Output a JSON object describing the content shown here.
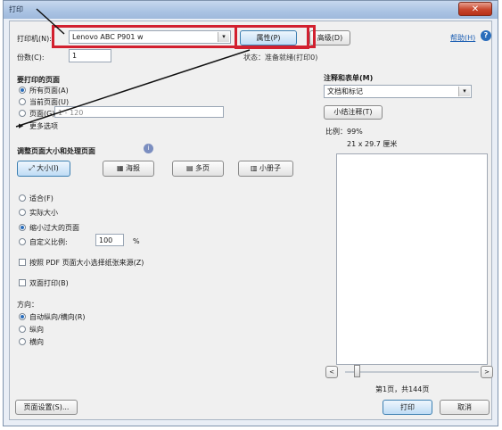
{
  "window": {
    "title": "打印",
    "close_glyph": "✕"
  },
  "printer": {
    "label": "打印机(N):",
    "value": "Lenovo ABC P901 w",
    "properties_button": "属性(P)",
    "advanced_button": "高级(D)",
    "help_link": "帮助(H)",
    "status": "状态：准备就绪(打印0)"
  },
  "copies": {
    "label": "份数(C):",
    "value": "1"
  },
  "range": {
    "heading": "要打印的页面",
    "options": [
      "所有页面(A)",
      "当前页面(U)",
      "页面(G)",
      "更多选项"
    ],
    "pages_value": "1 - 120"
  },
  "size": {
    "heading": "调整页面大小和处理页面",
    "tabs": [
      "大小(I)",
      "海报",
      "多页",
      "小册子"
    ],
    "options": [
      "适合(F)",
      "实际大小",
      "缩小过大的页面",
      "自定义比例:"
    ],
    "scale_value": "100",
    "scale_unit": "%",
    "pdf_size_checkbox": "按照 PDF 页面大小选择纸张来源(Z)",
    "double_sided_checkbox": "双面打印(B)"
  },
  "orientation": {
    "heading": "方向：",
    "options": [
      "自动纵向/横向(R)",
      "纵向",
      "横向"
    ]
  },
  "comments": {
    "heading": "注释和表单(M)",
    "value": "文档和标记",
    "summary_button": "小结注释(T)",
    "scale_label": "比例：99%",
    "paper_label": "21 x 29.7 厘米"
  },
  "nav": {
    "prev_glyph": "<",
    "next_glyph": ">",
    "page_status": "第1页，共144页"
  },
  "footer": {
    "page_setup": "页面设置(S)...",
    "print": "打印",
    "cancel": "取消"
  },
  "colors": {
    "annotation_red": "#d2202f",
    "accent_blue": "#1d5fb3"
  }
}
